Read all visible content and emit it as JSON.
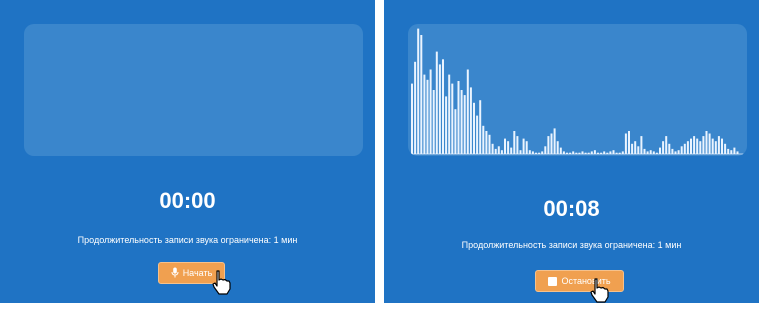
{
  "left": {
    "timer": "00:00",
    "note": "Продолжительность записи звука ограничена: 1 мин",
    "button_label": "Начать",
    "button_icon": "microphone-icon"
  },
  "right": {
    "timer": "00:08",
    "note": "Продолжительность записи звука ограничена: 1 мин",
    "button_label": "Остановить",
    "button_icon": "stop-icon",
    "waveform_levels": [
      0.55,
      0.72,
      0.98,
      0.93,
      0.62,
      0.58,
      0.66,
      0.5,
      0.8,
      0.7,
      0.74,
      0.45,
      0.62,
      0.55,
      0.35,
      0.57,
      0.5,
      0.46,
      0.66,
      0.52,
      0.4,
      0.3,
      0.42,
      0.22,
      0.18,
      0.15,
      0.08,
      0.04,
      0.06,
      0.03,
      0.12,
      0.1,
      0.05,
      0.18,
      0.14,
      0.03,
      0.12,
      0.1,
      0.03,
      0.02,
      0.01,
      0.01,
      0.02,
      0.06,
      0.14,
      0.16,
      0.2,
      0.1,
      0.05,
      0.02,
      0.01,
      0.01,
      0.02,
      0.01,
      0.01,
      0.02,
      0.01,
      0.01,
      0.02,
      0.03,
      0.01,
      0.01,
      0.02,
      0.01,
      0.02,
      0.03,
      0.01,
      0.01,
      0.02,
      0.16,
      0.18,
      0.08,
      0.1,
      0.06,
      0.14,
      0.04,
      0.02,
      0.03,
      0.02,
      0.01,
      0.05,
      0.1,
      0.14,
      0.08,
      0.04,
      0.02,
      0.03,
      0.06,
      0.08,
      0.1,
      0.12,
      0.14,
      0.12,
      0.1,
      0.14,
      0.18,
      0.16,
      0.12,
      0.1,
      0.14,
      0.12,
      0.08,
      0.04,
      0.03,
      0.05,
      0.02
    ]
  },
  "colors": {
    "panel_bg": "#1f73c4",
    "viz_bg": "#3a86cc",
    "button_bg": "#f0a050",
    "wave_color": "#eaf4ff"
  }
}
